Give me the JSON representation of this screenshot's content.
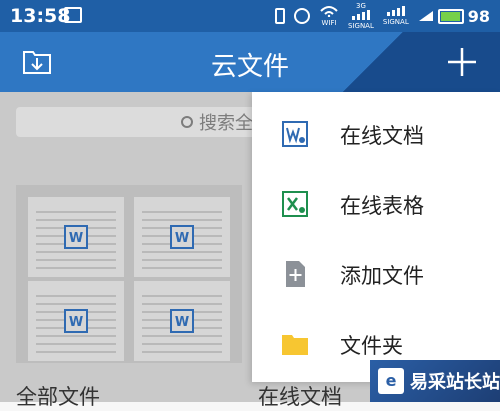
{
  "status_bar": {
    "time": "13:58",
    "wifi_label": "WIFI",
    "network_label": "3G",
    "signal_label": "SIGNAL",
    "battery_text": "98",
    "battery_level": 0.98
  },
  "app_bar": {
    "title": "云文件"
  },
  "search": {
    "text": "搜索全"
  },
  "menu": {
    "items": [
      {
        "label": "在线文档",
        "icon": "word-doc-icon",
        "color": "#2f6ab2"
      },
      {
        "label": "在线表格",
        "icon": "excel-sheet-icon",
        "color": "#1e8f4e"
      },
      {
        "label": "添加文件",
        "icon": "add-file-icon",
        "color": "#8c9198"
      },
      {
        "label": "文件夹",
        "icon": "folder-icon",
        "color": "#f7c631"
      }
    ]
  },
  "folder_card": {
    "doc_letter": "W"
  },
  "bottom": {
    "left": "全部文件",
    "right": "在线文档"
  },
  "watermark": {
    "text": "易采站长站"
  },
  "colors": {
    "app_bar": "#2f77c3",
    "status_bar": "#1f5fa6",
    "overlay": "#c9c9c9"
  }
}
